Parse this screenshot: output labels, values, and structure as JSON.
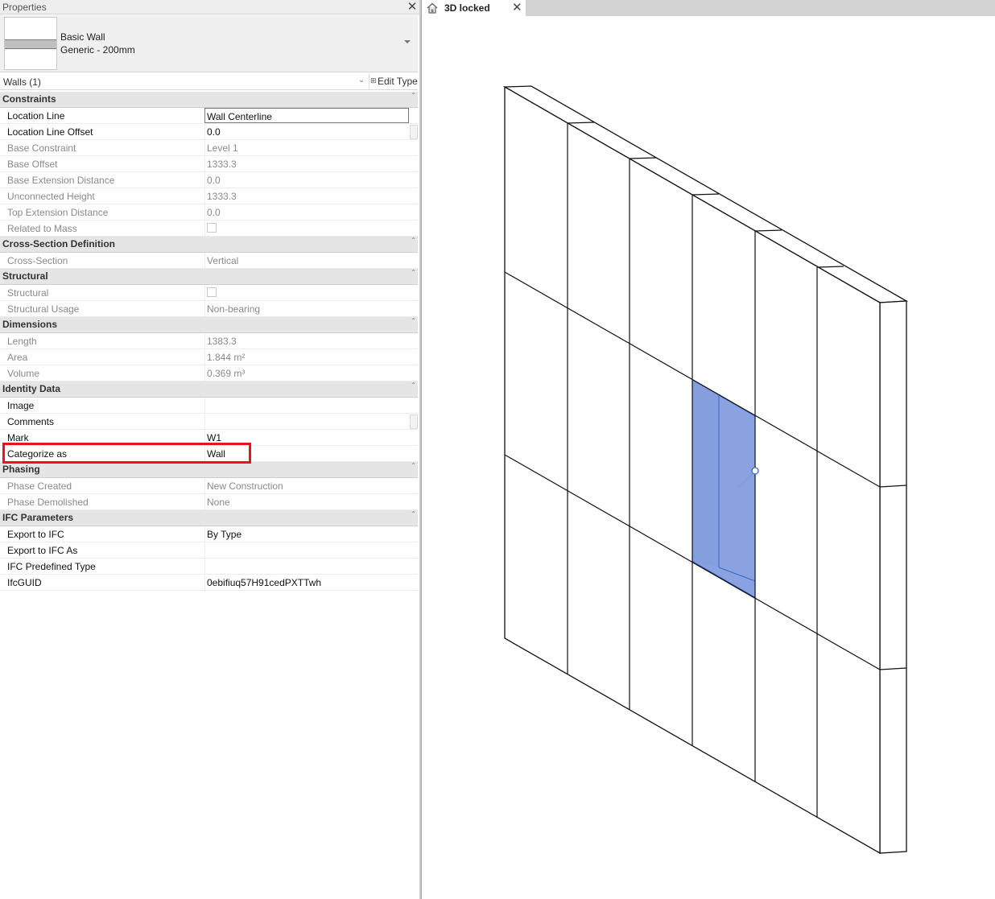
{
  "properties": {
    "title": "Properties",
    "type_family": "Basic Wall",
    "type_name": "Generic - 200mm",
    "filter": "Walls (1)",
    "edit_type": "Edit Type",
    "groups": [
      {
        "name": "Constraints",
        "rows": [
          {
            "name": "Location Line",
            "value": "Wall Centerline",
            "state": "editing"
          },
          {
            "name": "Location Line Offset",
            "value": "0.0",
            "state": "active"
          },
          {
            "name": "Base Constraint",
            "value": "Level 1",
            "state": "dim"
          },
          {
            "name": "Base Offset",
            "value": "1333.3",
            "state": "dim"
          },
          {
            "name": "Base Extension Distance",
            "value": "0.0",
            "state": "dim"
          },
          {
            "name": "Unconnected Height",
            "value": "1333.3",
            "state": "dim"
          },
          {
            "name": "Top Extension Distance",
            "value": "0.0",
            "state": "dim"
          },
          {
            "name": "Related to Mass",
            "value": "",
            "state": "dim",
            "checkbox": false
          }
        ]
      },
      {
        "name": "Cross-Section Definition",
        "rows": [
          {
            "name": "Cross-Section",
            "value": "Vertical",
            "state": "dim"
          }
        ]
      },
      {
        "name": "Structural",
        "rows": [
          {
            "name": "Structural",
            "value": "",
            "state": "dim",
            "checkbox": false
          },
          {
            "name": "Structural Usage",
            "value": "Non-bearing",
            "state": "dim"
          }
        ]
      },
      {
        "name": "Dimensions",
        "rows": [
          {
            "name": "Length",
            "value": "1383.3",
            "state": "dim"
          },
          {
            "name": "Area",
            "value": "1.844 m²",
            "state": "dim"
          },
          {
            "name": "Volume",
            "value": "0.369 m³",
            "state": "dim"
          }
        ]
      },
      {
        "name": "Identity Data",
        "rows": [
          {
            "name": "Image",
            "value": "",
            "state": "active"
          },
          {
            "name": "Comments",
            "value": "",
            "state": "active"
          },
          {
            "name": "Mark",
            "value": "W1",
            "state": "active"
          },
          {
            "name": "Categorize as",
            "value": "Wall",
            "state": "active"
          }
        ]
      },
      {
        "name": "Phasing",
        "rows": [
          {
            "name": "Phase Created",
            "value": "New Construction",
            "state": "dim"
          },
          {
            "name": "Phase Demolished",
            "value": "None",
            "state": "dim"
          }
        ]
      },
      {
        "name": "IFC Parameters",
        "rows": [
          {
            "name": "Export to IFC",
            "value": "By Type",
            "state": "active"
          },
          {
            "name": "Export to IFC As",
            "value": "",
            "state": "active"
          },
          {
            "name": "IFC Predefined Type",
            "value": "",
            "state": "active"
          },
          {
            "name": "IfcGUID",
            "value": "0ebifiuq57H91cedPXTTwh",
            "state": "active"
          }
        ]
      }
    ]
  },
  "view": {
    "tab_label": "3D locked"
  },
  "colors": {
    "highlight": "#e8141b",
    "selection": "#6f8fdc"
  }
}
